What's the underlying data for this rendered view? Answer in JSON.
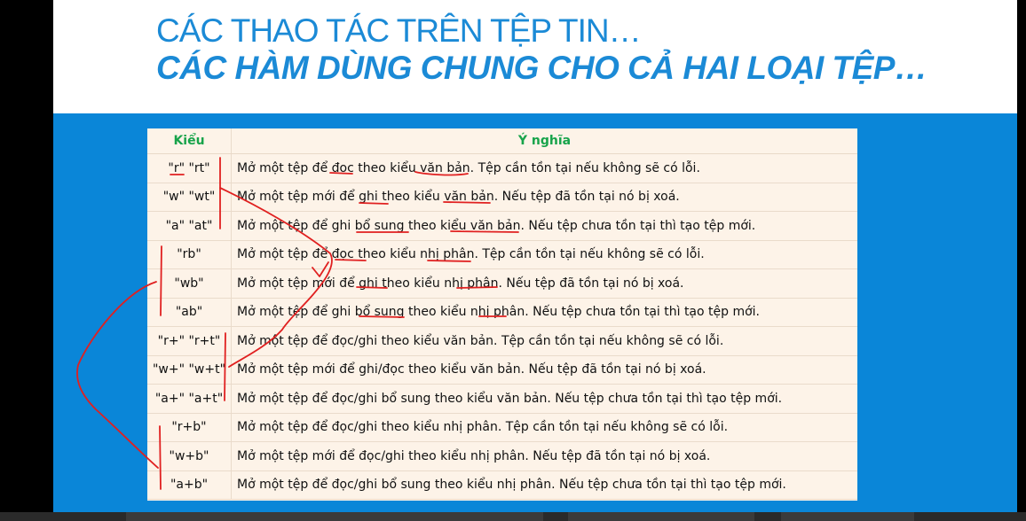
{
  "slide": {
    "title_line1": "CÁC THAO TÁC TRÊN TỆP TIN…",
    "title_line2": "CÁC HÀM DÙNG CHUNG CHO CẢ HAI LOẠI TỆP…"
  },
  "table": {
    "headers": [
      "Kiểu",
      "Ý nghĩa"
    ],
    "rows": [
      {
        "mode": "\"r\" \"rt\"",
        "meaning": "Mở một tệp để đọc theo kiểu văn bản. Tệp cần tồn tại nếu không sẽ có lỗi."
      },
      {
        "mode": "\"w\" \"wt\"",
        "meaning": "Mở một tệp mới để ghi theo kiểu văn bản. Nếu  tệp đã tồn tại nó bị xoá."
      },
      {
        "mode": "\"a\" \"at\"",
        "meaning": " Mở một tệp để ghi bổ sung theo kiểu văn bản. Nếu tệp chưa tồn tại thì tạo tệp mới."
      },
      {
        "mode": "\"rb\"",
        "meaning": "Mở một tệp để đọc theo kiểu nhị phân. Tệp cần tồn tại nếu không sẽ có lỗi."
      },
      {
        "mode": "\"wb\"",
        "meaning": "Mở một tệp mới để ghi theo kiểu nhị phân. Nếu tệp đã tồn tại nó bị xoá."
      },
      {
        "mode": "\"ab\"",
        "meaning": "Mở một tệp để ghi bổ sung theo kiểu nhị phân. Nếu tệp chưa tồn tại thì tạo tệp mới."
      },
      {
        "mode": "\"r+\" \"r+t\"",
        "meaning": "Mở một tệp để đọc/ghi theo kiểu văn bản. Tệp cần tồn tại nếu không sẽ có lỗi."
      },
      {
        "mode": "\"w+\" \"w+t\"",
        "meaning": "Mở một tệp mới để ghi/đọc theo kiểu văn bản.  Nếu tệp đã tồn tại nó bị xoá."
      },
      {
        "mode": "\"a+\" \"a+t\"",
        "meaning": "Mở một tệp để đọc/ghi bổ sung theo kiểu văn bản. Nếu tệp chưa tồn tại thì tạo tệp mới."
      },
      {
        "mode": "\"r+b\"",
        "meaning": "Mở một tệp để đọc/ghi theo kiểu nhị phân. Tệp cần tồn tại nếu không sẽ có lỗi."
      },
      {
        "mode": "\"w+b\"",
        "meaning": " Mở một tệp mới để đọc/ghi theo kiểu nhị phân. Nếu tệp đã tồn tại nó bị xoá."
      },
      {
        "mode": "\"a+b\"",
        "meaning": "Mở một tệp để đọc/ghi bổ sung theo kiểu nhị phân. Nếu tệp chưa tồn tại thì tạo tệp mới."
      }
    ]
  },
  "colors": {
    "title": "#1b8ad6",
    "slide_background": "#0a86d8",
    "table_background": "#fdf3e8",
    "header_text": "#17a34a",
    "annotation": "#e02020"
  }
}
